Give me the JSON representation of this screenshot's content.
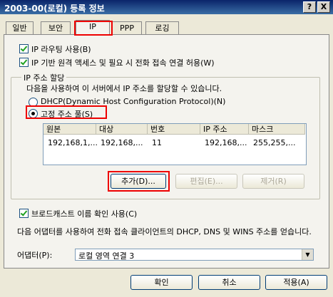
{
  "window": {
    "title": "2003-00(로컬) 등록 정보",
    "help_label": "?",
    "close_label": "X"
  },
  "tabs": [
    {
      "label": "일반"
    },
    {
      "label": "보안"
    },
    {
      "label": "IP"
    },
    {
      "label": "PPP"
    },
    {
      "label": "로깅"
    }
  ],
  "options": {
    "ip_routing": "IP 라우팅 사용(B)",
    "ip_remote_access": "IP 기반 원격 액세스 및 필요 시 전화 접속 연결 허용(W)"
  },
  "ip_assignment": {
    "group_label": "IP 주소 할당",
    "description": "다음을 사용하여 이 서버에서 IP 주소를 할당할 수 있습니다.",
    "dhcp_label": "DHCP(Dynamic Host Configuration Protocol)(N)",
    "static_pool_label": "고정 주소 풀(S)"
  },
  "pool_table": {
    "columns": [
      "원본",
      "대상",
      "번호",
      "IP 주소",
      "마스크"
    ],
    "rows": [
      [
        "192,168,1,...",
        "192,168,...",
        "11",
        "192,168,...",
        "255,255,..."
      ]
    ]
  },
  "pool_buttons": {
    "add": "추가(D)...",
    "edit": "편집(E)...",
    "remove": "제거(R)"
  },
  "broadcast": {
    "label": "브로드캐스트 이름 확인 사용(C)"
  },
  "adapter": {
    "description": "다음 어댑터를 사용하여 전화 접속 클라이언트의 DHCP, DNS 및 WINS 주소를 얻습니다.",
    "label": "어댑터(P):",
    "value": "로컬 영역 연결 3"
  },
  "dialog_buttons": {
    "ok": "확인",
    "cancel": "취소",
    "apply": "적용(A)"
  }
}
